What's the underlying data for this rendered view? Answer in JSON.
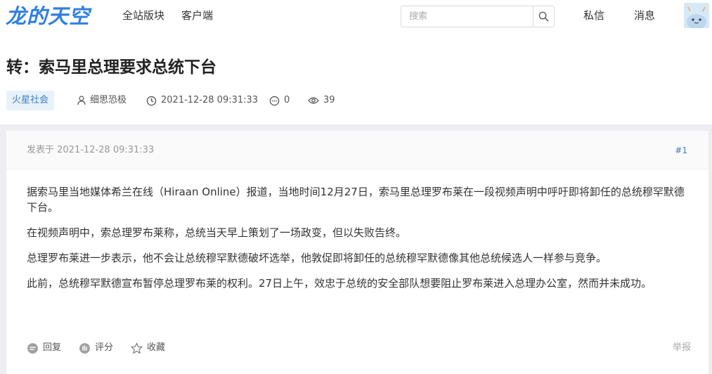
{
  "header": {
    "logo": "龙的天空",
    "nav": [
      "全站版块",
      "客户端"
    ],
    "search_placeholder": "搜索",
    "right_links": [
      "私信",
      "消息"
    ]
  },
  "thread": {
    "title": "转：索马里总理要求总统下台",
    "tag": "火星社会",
    "author": "细思恐极",
    "datetime": "2021-12-28 09:31:33",
    "comments": "0",
    "views": "39"
  },
  "post": {
    "posted_at": "发表于 2021-12-28 09:31:33",
    "floor": "#1",
    "paragraphs": [
      "据索马里当地媒体希兰在线（Hiraan Online）报道，当地时间12月27日，索马里总理罗布莱在一段视频声明中呼吁即将卸任的总统穆罕默德下台。",
      "在视频声明中，索总理罗布莱称，总统当天早上策划了一场政变，但以失败告终。",
      "总理罗布莱进一步表示，他不会让总统穆罕默德破坏选举，他敦促即将卸任的总统穆罕默德像其他总统候选人一样参与竞争。",
      "此前，总统穆罕默德宣布暂停总理罗布莱的权利。27日上午，效忠于总统的安全部队想要阻止罗布莱进入总理办公室，然而并未成功。"
    ],
    "actions": {
      "reply": "回复",
      "rate": "评分",
      "favorite": "收藏",
      "report": "举报"
    }
  },
  "colors": {
    "brand": "#2f7fe0",
    "tag_bg": "#e8f2fb",
    "tag_text": "#3d7dc2",
    "page_bg": "#ededf2"
  }
}
